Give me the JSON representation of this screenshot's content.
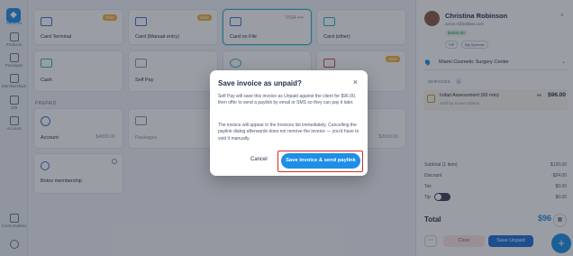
{
  "rail": {
    "items": [
      {
        "label": "Services"
      },
      {
        "label": "Products"
      },
      {
        "label": "Packages"
      },
      {
        "label": "Memberships"
      },
      {
        "label": "Gift"
      },
      {
        "label": "Account"
      },
      {
        "label": "Consumables"
      }
    ]
  },
  "cards": [
    {
      "label": "Card Terminal",
      "badge": "TEST"
    },
    {
      "label": "Card (Manual entry)",
      "badge": "TEST"
    },
    {
      "label": "Card on File",
      "masked": "VISA •••• "
    },
    {
      "label": "Card (other)"
    },
    {
      "label": "Cash"
    },
    {
      "label": "Self Pay"
    },
    {
      "badge": "TEST"
    }
  ],
  "prepaid": {
    "section_label": "PREPAID",
    "account_label": "Account",
    "account_amount": "$4000.00",
    "packages_label": "Packages",
    "packages_amount": "$2000.00",
    "botox_label": "Botox membership"
  },
  "client": {
    "name": "Christina Robinson",
    "email": "xxxxx.r@bobbes.com",
    "balance": "$4000.00",
    "tags": [
      "VIP",
      "Big Spender"
    ]
  },
  "location": "Miami Cosmetic Surgery Center",
  "services": {
    "header": "SERVICES",
    "count": "1",
    "item": {
      "name": "Initial Assessment (60 min)",
      "sub": "Sold by Susan Adams",
      "old_price": "$1",
      "price": "$96.00"
    }
  },
  "summary": {
    "subtotal_label": "Subtotal (1 item)",
    "subtotal": "$120.00",
    "discount_label": "Discount",
    "discount": "-$24.00",
    "tax_label": "Tax",
    "tax": "$0.00",
    "tip_label": "Tip",
    "tip": "$0.00",
    "total_label": "Total",
    "total": "$96"
  },
  "actions": {
    "clear": "Clear",
    "save_unpaid": "Save Unpaid",
    "fab": "+"
  },
  "modal": {
    "title": "Save invoice as unpaid?",
    "body1": "Self Pay will save this invoice as Unpaid against the client for $96.00, then offer to send a paylink by email or SMS so they can pay it later.",
    "body2": "The invoice will appear in the Invoices list immediately. Cancelling the paylink dialog afterwards does not remove the invoice — you'd have to void it manually.",
    "cancel": "Cancel",
    "confirm": "Save invoice & send paylink"
  }
}
